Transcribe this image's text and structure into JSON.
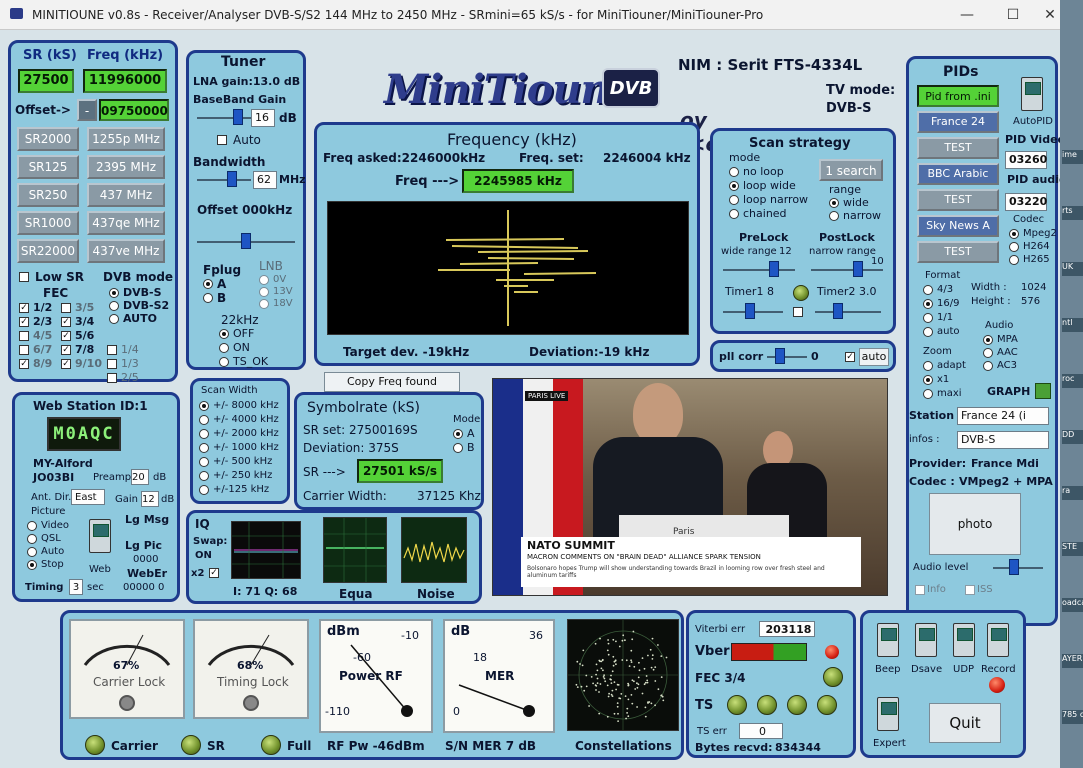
{
  "window": {
    "title": "MINITIOUNE v0.8s - Receiver/Analyser DVB-S/S2 144 MHz to 2450 MHz - SRmini=65 kS/s - for MiniTiouner/MiniTiouner-Pro",
    "min": "—",
    "max": "☐",
    "close": "✕"
  },
  "side_strip": [
    "ime",
    "rts",
    "UK",
    "ntl",
    "roc",
    "DD",
    "ra",
    "STE",
    "oadca",
    "AYER",
    "785 ch"
  ],
  "sr_panel": {
    "sr_label": "SR (kS)",
    "freq_label": "Freq (kHz)",
    "sr_value": "27500",
    "freq_value": "11996000",
    "offset_label": "Offset->",
    "offset_sign": "-",
    "offset_value": "09750000",
    "sr_buttons": [
      "SR2000",
      "SR125",
      "SR250",
      "SR1000",
      "SR22000"
    ],
    "freq_buttons": [
      "1255p MHz",
      "2395 MHz",
      "437 MHz",
      "437qe MHz",
      "437ve MHz"
    ],
    "low_sr": "Low SR",
    "dvb_mode": "DVB mode",
    "fec": "FEC",
    "dvb_opts": [
      "DVB-S",
      "DVB-S2",
      "AUTO"
    ],
    "fec_rows": [
      [
        "1/2",
        "3/5"
      ],
      [
        "2/3",
        "3/4"
      ],
      [
        "4/5",
        "5/6"
      ],
      [
        "6/7",
        "7/8"
      ],
      [
        "8/9",
        "9/10"
      ]
    ],
    "fec_right": [
      "1/4",
      "1/3",
      "2/5"
    ]
  },
  "tuner": {
    "title": "Tuner",
    "lna": "LNA gain:13.0 dB",
    "bb_label": "BaseBand Gain",
    "bb_value": "16",
    "bb_unit": "dB",
    "auto": "Auto",
    "bw_label": "Bandwidth",
    "bw_value": "62",
    "bw_unit": "MHz",
    "offset": "Offset 000kHz",
    "fplug": "Fplug",
    "lnb": "LNB",
    "fplug_a": "A",
    "fplug_b": "B",
    "lnb_opts": [
      "0V",
      "13V",
      "18V"
    ],
    "khz22": "22kHz",
    "khz_opts": [
      "OFF",
      "ON",
      "TS_OK"
    ]
  },
  "logo": {
    "text": "MiniTioune",
    "dvb": "DVB",
    "sig": "oy f<oIs21"
  },
  "nim": {
    "label": "NIM : Serit FTS-4334L",
    "tv_mode_label": "TV mode:",
    "tv_mode": "DVB-S"
  },
  "frequency": {
    "title": "Frequency (kHz)",
    "asked": "Freq asked:2246000kHz",
    "set_label": "Freq. set:",
    "set_value": "2246004 kHz",
    "freq_label": "Freq --->",
    "freq_value": "2245985 kHz",
    "target_dev": "Target dev. -19kHz",
    "deviation": "Deviation:-19 kHz"
  },
  "scan": {
    "title": "Scan strategy",
    "mode": "mode",
    "search": "1 search",
    "modes": [
      "no loop",
      "loop wide",
      "loop narrow",
      "chained"
    ],
    "range": "range",
    "ranges": [
      "wide",
      "narrow"
    ],
    "prelock": "PreLock",
    "postlock": "PostLock",
    "wide_range": "wide range",
    "wide_val": "12",
    "narrow_range": "narrow range",
    "narrow_val": "10",
    "timer1": "Timer1",
    "timer1_val": "8",
    "timer2": "Timer2",
    "timer2_val": "3.0"
  },
  "pll": {
    "label": "pll corr",
    "value": "0",
    "auto": "auto"
  },
  "copy_btn": "Copy Freq found",
  "scan_width": {
    "title": "Scan Width",
    "opts": [
      "+/- 8000 kHz",
      "+/- 4000 kHz",
      "+/- 2000 kHz",
      "+/- 1000 kHz",
      "+/- 500 kHz",
      "+/- 250 kHz",
      "+/-125 kHz"
    ]
  },
  "symbolrate": {
    "title": "Symbolrate (kS)",
    "set": "SR set:  27500169S",
    "dev": "Deviation: 375S",
    "sr_label": "SR --->",
    "sr_value": "27501 kS/s",
    "carrier": "Carrier Width:",
    "carrier_val": "37125 Khz",
    "mode": "Mode",
    "mode_a": "A",
    "mode_b": "B"
  },
  "video": {
    "channel_tag": "PARIS LIVE",
    "headline": "NATO SUMMIT",
    "subline": "MACRON COMMENTS ON \"BRAIN DEAD\" ALLIANCE SPARK TENSION",
    "ticker": "Bolsonaro hopes Trump will show understanding towards Brazil in looming row over fresh steel and aluminum tariffs",
    "podium": "Paris"
  },
  "pids": {
    "title": "PIDs",
    "pid_ini": "Pid from .ini",
    "autopid": "AutoPID",
    "channels": [
      "France 24",
      "TEST",
      "BBC Arabic",
      "TEST",
      "Sky News A",
      "TEST"
    ],
    "pid_video": "PID Video",
    "pid_video_val": "03260",
    "pid_audio": "PID audio",
    "pid_audio_val": "03220",
    "codec": "Codec",
    "codecs": [
      "Mpeg2",
      "H264",
      "H265"
    ],
    "format": "Format",
    "formats": [
      "4/3",
      "16/9",
      "1/1",
      "auto"
    ],
    "width": "Width :",
    "width_val": "1024",
    "height": "Height :",
    "height_val": "576",
    "audio": "Audio",
    "audios": [
      "MPA",
      "AAC",
      "AC3"
    ],
    "zoom": "Zoom",
    "zooms": [
      "adapt",
      "x1",
      "maxi"
    ],
    "graph": "GRAPH",
    "station_label": "Station",
    "station_val": "France 24 (i",
    "infos_label": "infos :",
    "infos_val": "DVB-S",
    "provider_label": "Provider:",
    "provider_val": "France Mdi",
    "codec_label": "Codec :",
    "codec_val": "VMpeg2 + MPA",
    "photo": "photo",
    "audio_level": "Audio level",
    "info": "Info",
    "iss": "ISS"
  },
  "web": {
    "title": "Web Station ID:1",
    "lcd": "M0AQC",
    "call": "MY-Alford",
    "loc": "JO03BI",
    "preamp": "Preamp",
    "preamp_val": "20",
    "preamp_unit": "dB",
    "ant": "Ant. Dir.",
    "ant_val": "East",
    "gain": "Gain",
    "gain_val": "12",
    "gain_unit": "dB",
    "picture": "Picture",
    "pics": [
      "Video",
      "QSL",
      "Auto",
      "Stop"
    ],
    "lg_msg": "Lg Msg",
    "lg_pic": "Lg Pic",
    "lg_pic_val": "0000",
    "weber": "WebEr",
    "weber_val": "00000 0",
    "web": "Web",
    "timing": "Timing",
    "timing_val": "3",
    "timing_unit": "sec"
  },
  "iq": {
    "title": "IQ",
    "swap": "Swap:",
    "on": "ON",
    "x2": "x2",
    "iq_vals": "I: 71 Q: 68",
    "equa": "Equa",
    "noise": "Noise"
  },
  "bottom": {
    "carrier_pct": "67%",
    "carrier_lock": "Carrier Lock",
    "timing_pct": "68%",
    "timing_lock": "Timing Lock",
    "dbm": "dBm",
    "dbm_top": "-10",
    "dbm_mid": "-60",
    "power_rf": "Power RF",
    "dbm_low": "-110",
    "db": "dB",
    "db_top": "36",
    "db_mid": "18",
    "mer": "MER",
    "db_low": "0",
    "led_carrier": "Carrier",
    "led_sr": "SR",
    "led_full": "Full",
    "rf_pw": "RF Pw -46dBm",
    "snmer": "S/N MER  7 dB",
    "constellations": "Constellations"
  },
  "stats": {
    "viterbi_label": "Viterbi err",
    "viterbi_val": "203118",
    "vber": "Vber",
    "fec": "FEC 3/4",
    "ts": "TS",
    "ts_err": "TS err",
    "ts_err_val": "0",
    "bytes": "Bytes recvd:",
    "bytes_val": "834344"
  },
  "controls": {
    "beep": "Beep",
    "dsave": "Dsave",
    "udp": "UDP",
    "record": "Record",
    "expert": "Expert",
    "quit": "Quit"
  }
}
